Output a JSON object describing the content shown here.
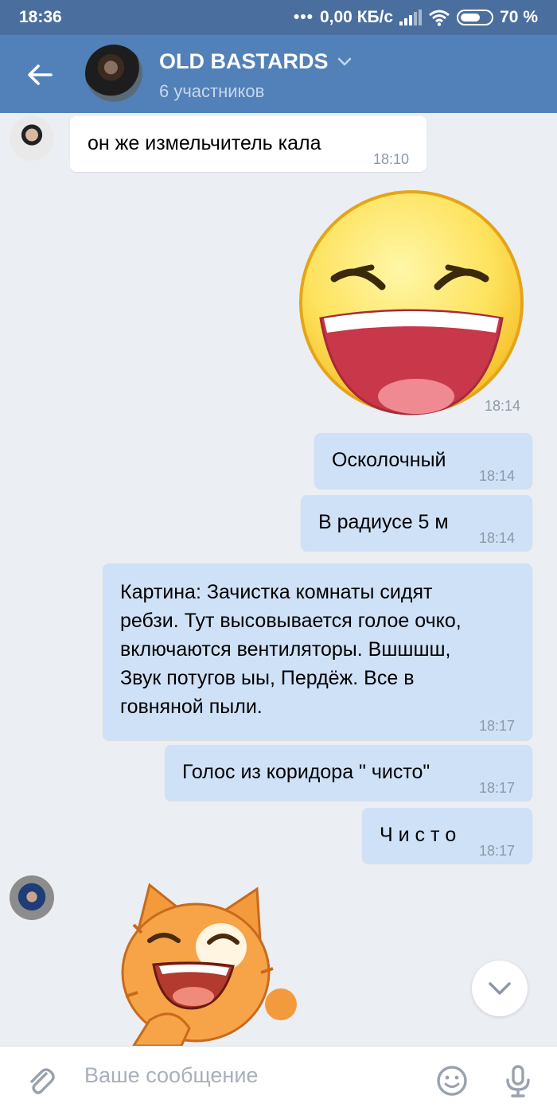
{
  "status_bar": {
    "time": "18:36",
    "dots": "•••",
    "network_speed": "0,00 КБ/с",
    "battery": "70 %"
  },
  "header": {
    "title": "OLD BASTARDS",
    "subtitle": "6 участников"
  },
  "messages": [
    {
      "text": "он же измельчитель кала",
      "time": "18:10",
      "direction": "in"
    },
    {
      "sticker": "laughing-emoji-sticker",
      "time": "18:14",
      "direction": "out"
    },
    {
      "text": "Осколочный",
      "time": "18:14",
      "direction": "out"
    },
    {
      "text": "В радиусе 5 м",
      "time": "18:14",
      "direction": "out"
    },
    {
      "text": "Картина: Зачистка комнаты сидят ребзи. Тут высовывается голое очко, включаются вентиляторы. Вшшшш, Звук потугов ыы, Пердёж. Все в говняной пыли.",
      "time": "18:17",
      "direction": "out"
    },
    {
      "text": "Голос из коридора \" чисто\"",
      "time": "18:17",
      "direction": "out"
    },
    {
      "text": "Ч и с т о",
      "time": "18:17",
      "direction": "out"
    },
    {
      "sticker": "laughing-cat-sticker",
      "direction": "in"
    }
  ],
  "input": {
    "placeholder": "Ваше сообщение"
  },
  "colors": {
    "status_bar": "#4a6f9e",
    "header": "#5181b8",
    "background": "#ebeef3",
    "outgoing_bubble": "#cfe1f7",
    "incoming_bubble": "#ffffff"
  }
}
